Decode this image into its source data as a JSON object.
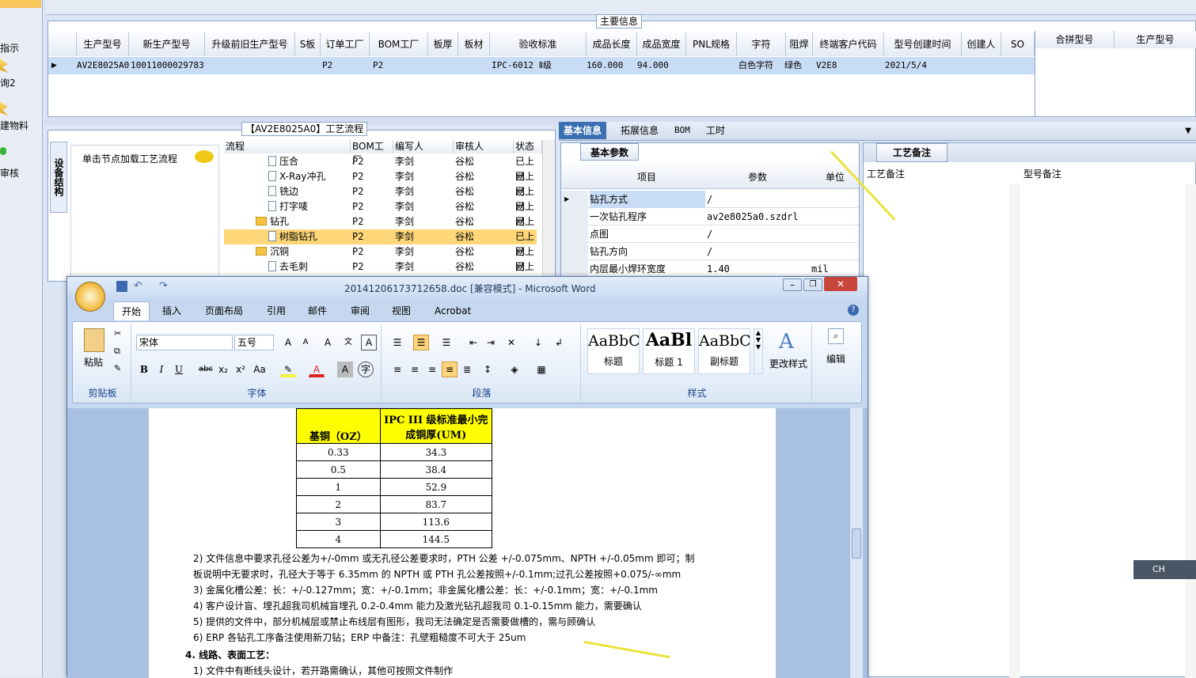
{
  "leftnav": {
    "items": [
      "指示",
      "询2",
      "建物料",
      "审核"
    ]
  },
  "main_info": {
    "legend": "主要信息",
    "columns": [
      "生产型号",
      "新生产型号",
      "升级前旧生产型号",
      "S板",
      "订单工厂",
      "BOM工厂",
      "板厚",
      "板材",
      "验收标准",
      "成品长度",
      "成品宽度",
      "PNL规格",
      "字符",
      "阻焊",
      "终端客户代码",
      "型号创建时间",
      "创建人",
      "SO"
    ],
    "row": {
      "生产型号": "AV2E8025A0",
      "新生产型号": "10011000029783",
      "订单工厂": "P2",
      "BOM工厂": "P2",
      "验收标准": "IPC-6012 Ⅱ级",
      "成品长度": "160.000",
      "成品宽度": "94.000",
      "字符": "白色字符",
      "阻焊": "绿色",
      "终端客户代码": "V2E8",
      "型号创建时间": "2021/5/4"
    },
    "side_columns": [
      "合拼型号",
      "生产型号"
    ]
  },
  "process": {
    "legend": "【AV2E8025A0】工艺流程",
    "side_tab": "设备结构",
    "hint": "单击节点加载工艺流程",
    "columns": [
      "流程",
      "BOM工厂",
      "编写人",
      "审核人",
      "状态"
    ],
    "rows": [
      {
        "name": "压合",
        "type": "doc",
        "bom": "P2",
        "writer": "李剑",
        "reviewer": "谷松",
        "status": "已上网"
      },
      {
        "name": "X-Ray冲孔",
        "type": "doc",
        "bom": "P2",
        "writer": "李剑",
        "reviewer": "谷松",
        "status": "已上网"
      },
      {
        "name": "铣边",
        "type": "doc",
        "bom": "P2",
        "writer": "李剑",
        "reviewer": "谷松",
        "status": "已上网"
      },
      {
        "name": "打字唛",
        "type": "doc",
        "bom": "P2",
        "writer": "李剑",
        "reviewer": "谷松",
        "status": "已上网"
      },
      {
        "name": "钻孔",
        "type": "folder",
        "bom": "P2",
        "writer": "李剑",
        "reviewer": "谷松",
        "status": "已上网"
      },
      {
        "name": "树脂钻孔",
        "type": "doc",
        "bom": "P2",
        "writer": "李剑",
        "reviewer": "谷松",
        "status": "已上网",
        "highlight": true
      },
      {
        "name": "沉铜",
        "type": "folder",
        "bom": "P2",
        "writer": "李剑",
        "reviewer": "谷松",
        "status": "已上网"
      },
      {
        "name": "去毛刺",
        "type": "doc",
        "bom": "P2",
        "writer": "李剑",
        "reviewer": "谷松",
        "status": "已上网"
      }
    ]
  },
  "right": {
    "tabs": [
      "基本信息",
      "拓展信息",
      "BOM",
      "工时"
    ],
    "basic_tab": "基本参数",
    "param_columns": [
      "项目",
      "参数",
      "单位"
    ],
    "params": [
      {
        "item": "钻孔方式",
        "value": "/",
        "unit": ""
      },
      {
        "item": "一次钻孔程序",
        "value": "av2e8025a0.szdrl",
        "unit": ""
      },
      {
        "item": "点图",
        "value": "/",
        "unit": ""
      },
      {
        "item": "钻孔方向",
        "value": "/",
        "unit": ""
      },
      {
        "item": "内层最小焊环宽度",
        "value": "1.40",
        "unit": "mil"
      }
    ],
    "remark_tab": "工艺备注",
    "remark_columns": [
      "工艺备注",
      "型号备注"
    ]
  },
  "word": {
    "title": "20141206173712658.doc [兼容模式] - Microsoft Word",
    "tabs": [
      "开始",
      "插入",
      "页面布局",
      "引用",
      "邮件",
      "审阅",
      "视图",
      "Acrobat"
    ],
    "font_name": "宋体",
    "font_size": "五号",
    "paste": "粘贴",
    "clipboard": "剪贴板",
    "font_group": "字体",
    "para_group": "段落",
    "style_group": "样式",
    "styles": [
      {
        "sample": "AaBbC",
        "name": "标题"
      },
      {
        "sample": "AaBl",
        "name": "标题 1"
      },
      {
        "sample": "AaBbC",
        "name": "副标题"
      }
    ],
    "change_style": "更改样式",
    "edit": "编辑",
    "table": {
      "headers": [
        "基铜（OZ）",
        "IPC III 级标准最小完成铜厚(UM)"
      ],
      "rows": [
        [
          "0.33",
          "34.3"
        ],
        [
          "0.5",
          "38.4"
        ],
        [
          "1",
          "52.9"
        ],
        [
          "2",
          "83.7"
        ],
        [
          "3",
          "113.6"
        ],
        [
          "4",
          "144.5"
        ]
      ]
    },
    "paragraphs": [
      "2)  文件信息中要求孔径公差为+/-0mm 或无孔径公差要求时，PTH 公差 +/-0.075mm、NPTH +/-0.05mm 即可；制",
      "     板说明中无要求时，孔径大于等于 6.35mm 的 NPTH 或 PTH 孔公差按照+/-0.1mm;过孔公差按照+0.075/-∞mm",
      "3)  金属化槽公差：长：+/-0.127mm；宽：+/-0.1mm；非金属化槽公差：长：+/-0.1mm；宽：+/-0.1mm",
      "4)  客户设计盲、埋孔超我司机械盲埋孔 0.2-0.4mm 能力及激光钻孔超我司 0.1-0.15mm 能力，需要确认",
      "5)  提供的文件中，部分机械层或禁止布线层有图形，我司无法确定是否需要做槽的，需与顾确认",
      "6)  ERP 各钻孔工序备注使用新刀钻；ERP 中备注：孔壁粗糙度不可大于 25um",
      "4.   线路、表面工艺：",
      "1)  文件中有断线头设计，若开路需确认，其他可按照文件制作"
    ]
  },
  "ime": {
    "label": "CH"
  },
  "colors": {
    "annotation_arrow": "#e9e33b",
    "selection": "#ffd779",
    "tab_active": "#3a6fb2"
  }
}
